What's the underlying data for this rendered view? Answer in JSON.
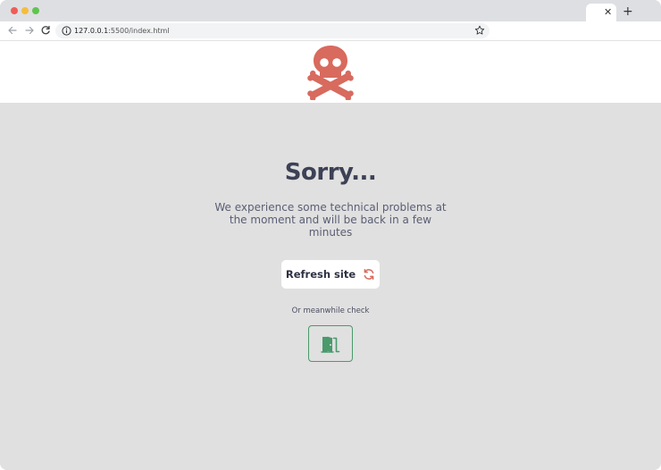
{
  "browser": {
    "tab_close": "✕",
    "new_tab": "+",
    "url_host": "127.0.0.1",
    "url_rest": ":5500/index.html"
  },
  "header": {
    "logo_icon": "skull-crossbones-icon",
    "logo_color": "#d86a5e"
  },
  "main": {
    "title": "Sorry...",
    "message": "We experience some technical problems at the moment and will be back in a few minutes",
    "refresh_label": "Refresh site",
    "refresh_icon": "refresh-icon",
    "meanwhile_text": "Or meanwhile check",
    "exit_icon": "door-exit-icon",
    "accent_red": "#d86a5e",
    "accent_green": "#4a9a6c",
    "background": "#e0e0e0"
  }
}
